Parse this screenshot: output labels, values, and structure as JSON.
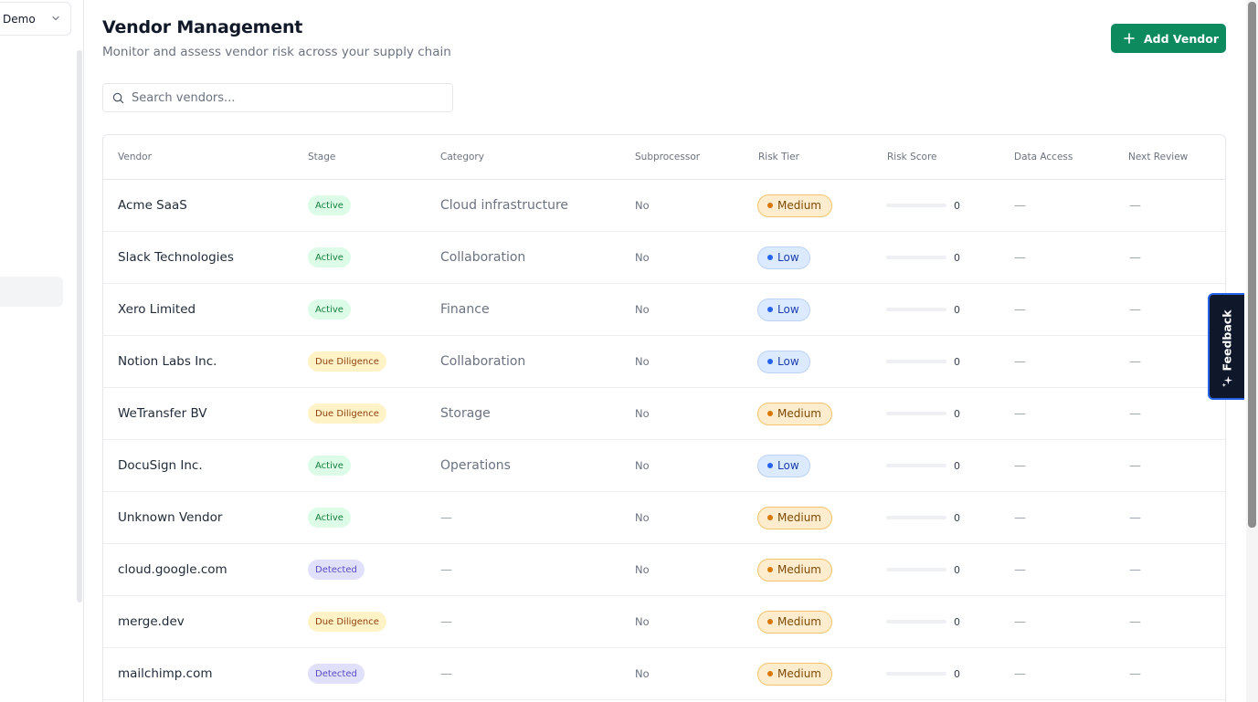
{
  "sidebar": {
    "workspace": "Demo"
  },
  "header": {
    "title": "Vendor Management",
    "subtitle": "Monitor and assess vendor risk across your supply chain",
    "add_button": "Add Vendor"
  },
  "search": {
    "placeholder": "Search vendors..."
  },
  "table": {
    "columns": [
      "Vendor",
      "Stage",
      "Category",
      "Subprocessor",
      "Risk Tier",
      "Risk Score",
      "Data Access",
      "Next Review"
    ],
    "rows": [
      {
        "vendor": "Acme SaaS",
        "stage": "Active",
        "category": "Cloud infrastructure",
        "subprocessor": "No",
        "risk_tier": "Medium",
        "risk_score": "0",
        "data_access": "—",
        "next_review": "—"
      },
      {
        "vendor": "Slack Technologies",
        "stage": "Active",
        "category": "Collaboration",
        "subprocessor": "No",
        "risk_tier": "Low",
        "risk_score": "0",
        "data_access": "—",
        "next_review": "—"
      },
      {
        "vendor": "Xero Limited",
        "stage": "Active",
        "category": "Finance",
        "subprocessor": "No",
        "risk_tier": "Low",
        "risk_score": "0",
        "data_access": "—",
        "next_review": "—"
      },
      {
        "vendor": "Notion Labs Inc.",
        "stage": "Due Diligence",
        "category": "Collaboration",
        "subprocessor": "No",
        "risk_tier": "Low",
        "risk_score": "0",
        "data_access": "—",
        "next_review": "—"
      },
      {
        "vendor": "WeTransfer BV",
        "stage": "Due Diligence",
        "category": "Storage",
        "subprocessor": "No",
        "risk_tier": "Medium",
        "risk_score": "0",
        "data_access": "—",
        "next_review": "—"
      },
      {
        "vendor": "DocuSign Inc.",
        "stage": "Active",
        "category": "Operations",
        "subprocessor": "No",
        "risk_tier": "Low",
        "risk_score": "0",
        "data_access": "—",
        "next_review": "—"
      },
      {
        "vendor": "Unknown Vendor",
        "stage": "Active",
        "category": "—",
        "subprocessor": "No",
        "risk_tier": "Medium",
        "risk_score": "0",
        "data_access": "—",
        "next_review": "—"
      },
      {
        "vendor": "cloud.google.com",
        "stage": "Detected",
        "category": "—",
        "subprocessor": "No",
        "risk_tier": "Medium",
        "risk_score": "0",
        "data_access": "—",
        "next_review": "—"
      },
      {
        "vendor": "merge.dev",
        "stage": "Due Diligence",
        "category": "—",
        "subprocessor": "No",
        "risk_tier": "Medium",
        "risk_score": "0",
        "data_access": "—",
        "next_review": "—"
      },
      {
        "vendor": "mailchimp.com",
        "stage": "Detected",
        "category": "—",
        "subprocessor": "No",
        "risk_tier": "Medium",
        "risk_score": "0",
        "data_access": "—",
        "next_review": "—"
      }
    ]
  },
  "feedback": {
    "label": "Feedback"
  },
  "colors": {
    "accent": "#0e8a5f",
    "stage_active": "#dcfce7",
    "stage_due_diligence": "#fef3c7",
    "stage_detected": "#e0e0fb",
    "risk_medium": "#fdeccd",
    "risk_low": "#dbeafe"
  },
  "icons": {
    "add": "plus-icon",
    "search": "search-icon",
    "workspace": "chevron-down-icon",
    "feedback": "sparkle-icon"
  }
}
